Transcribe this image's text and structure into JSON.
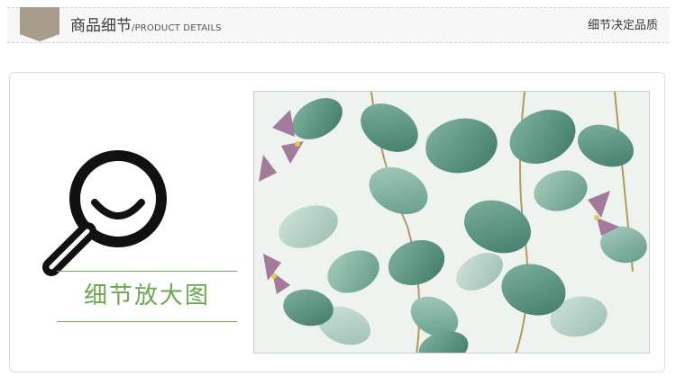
{
  "header": {
    "title": "商品细节",
    "subtitle": "/PRODUCT DETAILS",
    "tagline": "细节决定品质",
    "tag_color": "#a89c8a"
  },
  "panel": {
    "label": "细节放大图",
    "accent_color": "#6aa84f",
    "magnifier_icon": "magnifier-smile-icon"
  }
}
